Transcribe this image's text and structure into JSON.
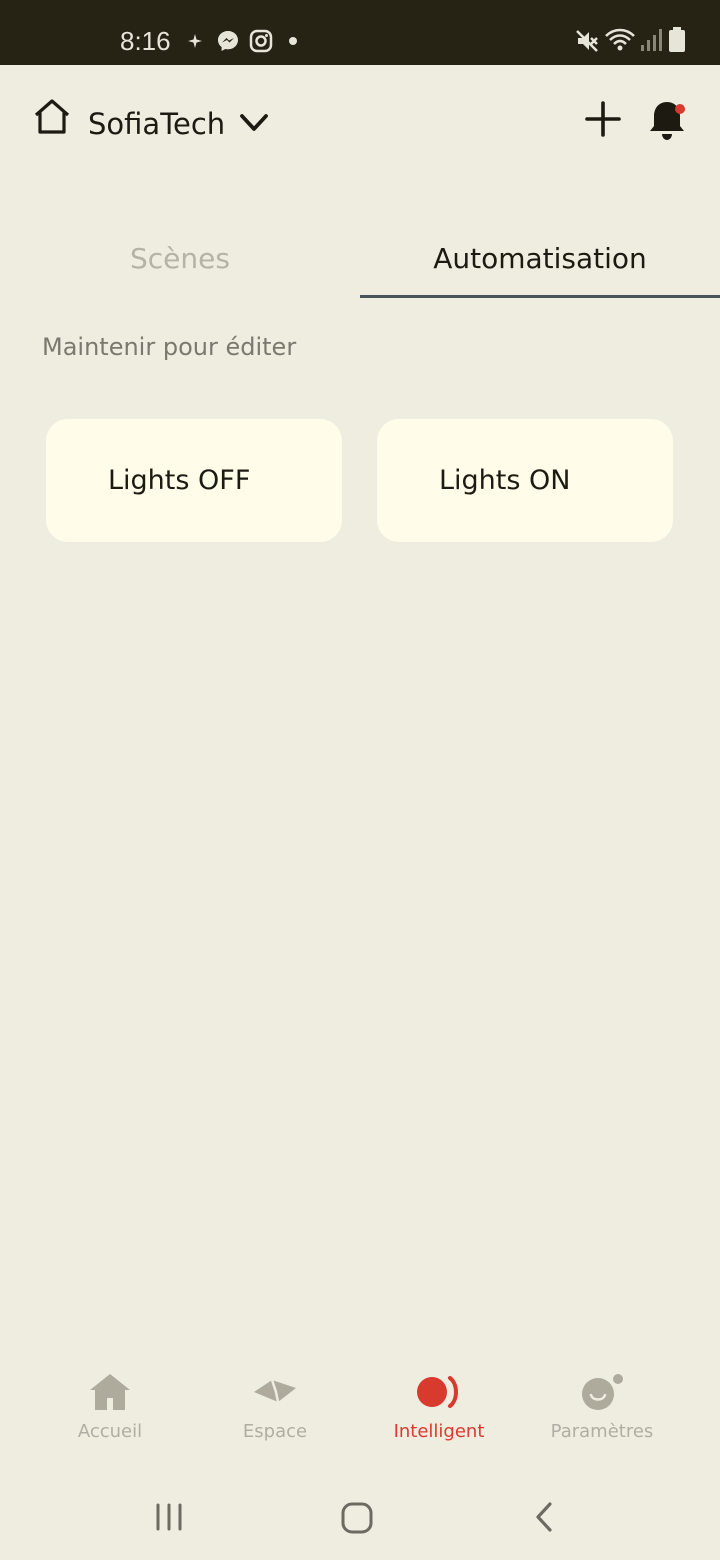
{
  "status_bar": {
    "time": "8:16",
    "icons_left": [
      "sparkle-icon",
      "messenger-icon",
      "instagram-icon",
      "dot-icon"
    ],
    "icons_right": [
      "mute-icon",
      "wifi-icon",
      "signal-icon",
      "battery-icon"
    ]
  },
  "header": {
    "home_name": "SofiaTech",
    "icons": [
      "home-outline-icon",
      "chevron-down-icon",
      "plus-icon",
      "bell-icon"
    ],
    "notification_dot_color": "#d83a2e"
  },
  "tabs": [
    {
      "label": "Scènes",
      "active": false
    },
    {
      "label": "Automatisation",
      "active": true
    }
  ],
  "hint": "Maintenir pour éditer",
  "cards": [
    {
      "label": "Lights OFF"
    },
    {
      "label": "Lights ON"
    }
  ],
  "bottom_nav": [
    {
      "label": "Accueil",
      "icon": "house-icon",
      "active": false
    },
    {
      "label": "Espace",
      "icon": "space-icon",
      "active": false
    },
    {
      "label": "Intelligent",
      "icon": "smart-icon",
      "active": true
    },
    {
      "label": "Paramètres",
      "icon": "settings-face-icon",
      "active": false
    }
  ],
  "system_nav": [
    "recents-icon",
    "home-circle-icon",
    "back-icon"
  ],
  "colors": {
    "background": "#efede0",
    "card": "#fffde9",
    "accent": "#d83a2e",
    "status_bar": "#262214"
  }
}
